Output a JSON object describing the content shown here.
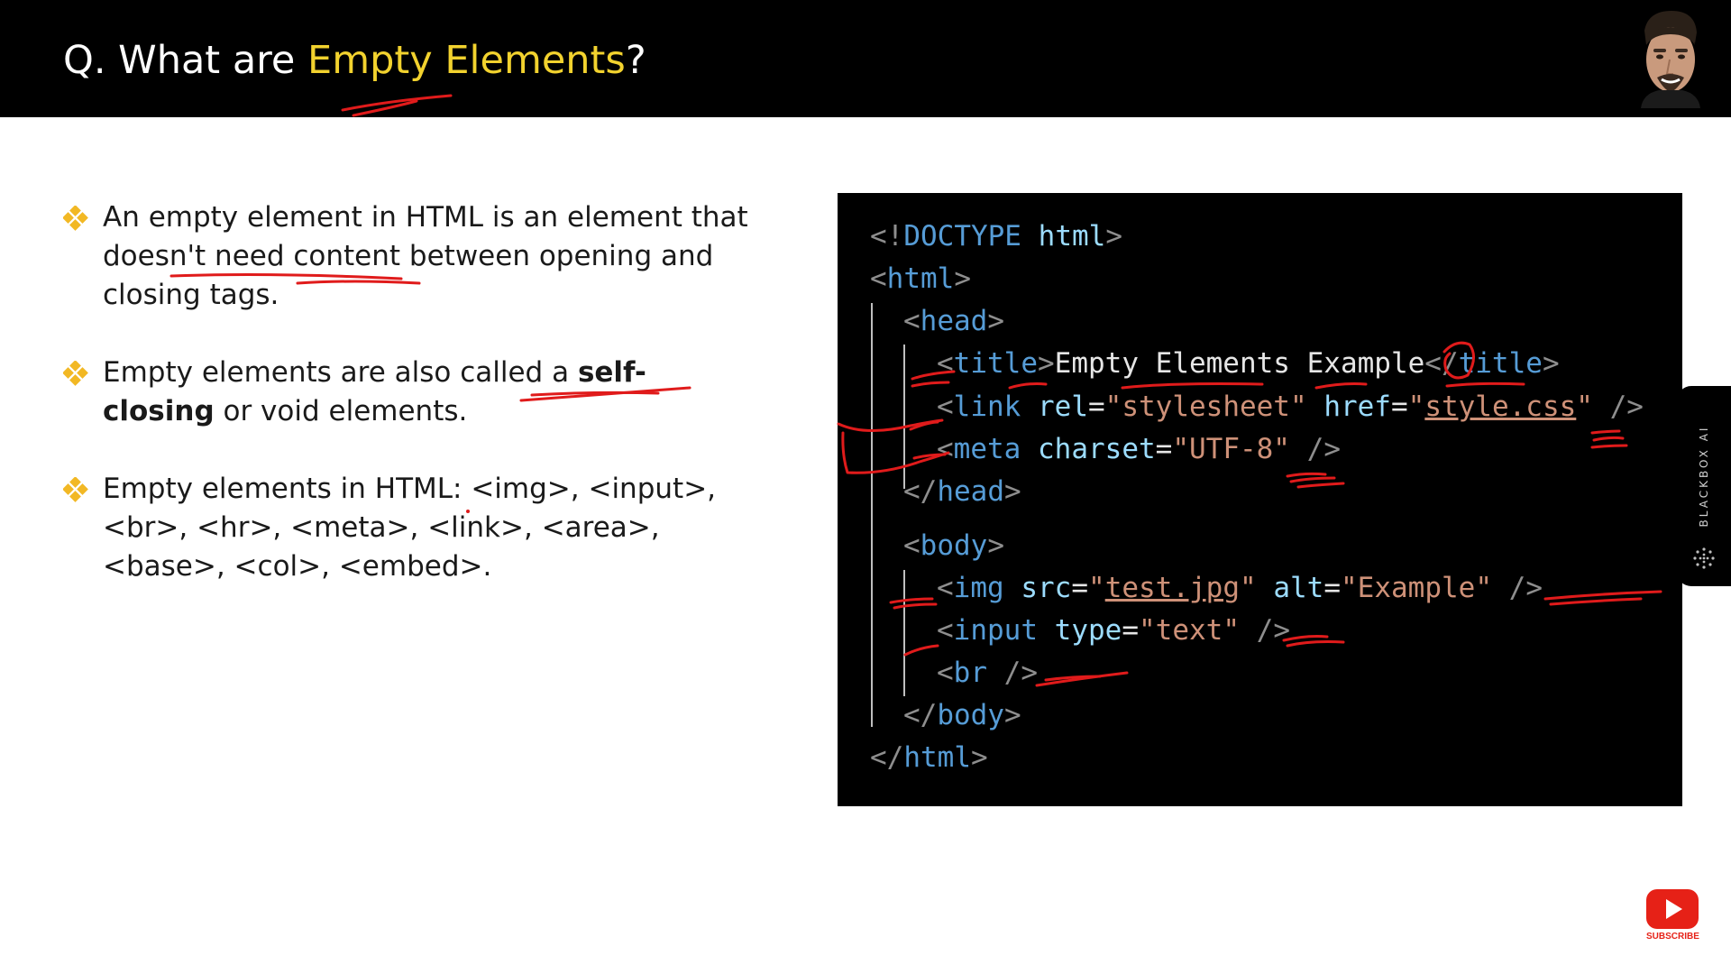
{
  "header": {
    "title_prefix": "Q. What are ",
    "title_highlight": "Empty Elements",
    "title_suffix": "?"
  },
  "bullets": [
    {
      "text": "An empty element in HTML is an element that doesn't need content between opening and closing tags."
    },
    {
      "text_before": "Empty elements are also called a ",
      "bold": "self-closing",
      "text_after": " or void elements."
    },
    {
      "text": "Empty elements in HTML: <img>, <input>, <br>, <hr>, <meta>, <link>, <area>, <base>, <col>, <embed>."
    }
  ],
  "code": {
    "doctype_open": "<!",
    "doctype_kw": "DOCTYPE",
    "doctype_attr": "html",
    "doctype_close": ">",
    "html_tag": "html",
    "head_tag": "head",
    "title_tag": "title",
    "title_text": "Empty Elements Example",
    "link_tag": "link",
    "link_attr1": "rel",
    "link_val1": "\"stylesheet\"",
    "link_attr2": "href",
    "link_val2_q1": "\"",
    "link_val2": "style.css",
    "link_val2_q2": "\"",
    "meta_tag": "meta",
    "meta_attr": "charset",
    "meta_val": "\"UTF-8\"",
    "body_tag": "body",
    "img_tag": "img",
    "img_attr1": "src",
    "img_val1_q1": "\"",
    "img_val1": "test.jpg",
    "img_val1_q2": "\"",
    "img_attr2": "alt",
    "img_val2": "\"Example\"",
    "input_tag": "input",
    "input_attr": "type",
    "input_val": "\"text\"",
    "br_tag": "br"
  },
  "side_tab": {
    "label": "BLACKBOX AI"
  },
  "subscribe": {
    "label": "SUBSCRIBE"
  },
  "colors": {
    "header_bg": "#000000",
    "title_highlight": "#f2d22e",
    "bullet_mark": "#f2b824",
    "tag": "#569cd6",
    "attribute": "#9cdcfe",
    "string": "#ce9178",
    "punctuation": "#8e8e8e",
    "annotation": "#e01b1b"
  }
}
